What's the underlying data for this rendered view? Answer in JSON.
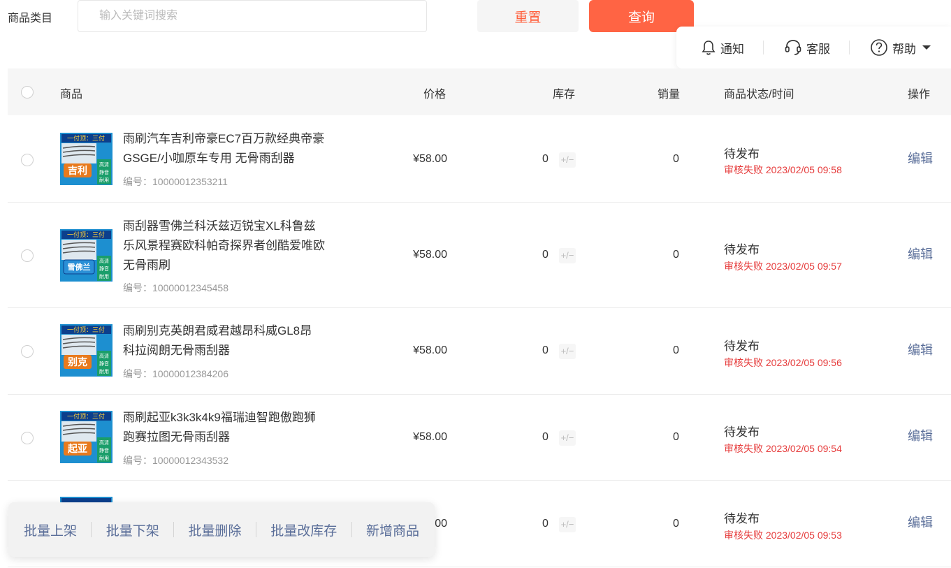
{
  "filter": {
    "category_label": "商品类目",
    "search_placeholder": "输入关键词搜索",
    "reset_label": "重置",
    "query_label": "查询"
  },
  "help_panel": {
    "notify_label": "通知",
    "service_label": "客服",
    "help_label": "帮助"
  },
  "table": {
    "columns": {
      "product": "商品",
      "price": "价格",
      "stock": "库存",
      "sales": "销量",
      "status": "商品状态/时间",
      "actions": "操作"
    },
    "rows": [
      {
        "badge_top": "一付顶：三付",
        "badge_brand": "吉利",
        "badge_side": [
          "高清",
          "静音",
          "耐用"
        ],
        "title": "雨刷汽车吉利帝豪EC7百万款经典帝豪GSGE/小咖原车专用 无骨雨刮器",
        "code": "编号：10000012353211",
        "price": "¥58.00",
        "stock": "0",
        "stock_edit": "+/−",
        "sales": "0",
        "status": "待发布",
        "time": "审核失败 2023/02/05 09:58",
        "edit": "编辑"
      },
      {
        "badge_top": "一付顶：三付",
        "badge_brand": "雪佛兰",
        "badge_side": [
          "高清",
          "静音",
          "耐用"
        ],
        "title": "雨刮器雪佛兰科沃兹迈锐宝XL科鲁兹乐风景程赛欧科帕奇探界者创酷爱唯欧无骨雨刷",
        "code": "编号：10000012345458",
        "price": "¥58.00",
        "stock": "0",
        "stock_edit": "+/−",
        "sales": "0",
        "status": "待发布",
        "time": "审核失败 2023/02/05 09:57",
        "edit": "编辑"
      },
      {
        "badge_top": "一付顶：三付",
        "badge_brand": "别克",
        "badge_side": [
          "高清",
          "静音",
          "耐用"
        ],
        "title": "雨刷别克英朗君威君越昂科威GL8昂科拉阅朗无骨雨刮器",
        "code": "编号：10000012384206",
        "price": "¥58.00",
        "stock": "0",
        "stock_edit": "+/−",
        "sales": "0",
        "status": "待发布",
        "time": "审核失败 2023/02/05 09:56",
        "edit": "编辑"
      },
      {
        "badge_top": "一付顶：三付",
        "badge_brand": "起亚",
        "badge_side": [
          "高清",
          "静音",
          "耐用"
        ],
        "title": "雨刷起亚k3k3k4k9福瑞迪智跑傲跑狮跑赛拉图无骨雨刮器",
        "code": "编号：10000012343532",
        "price": "¥58.00",
        "stock": "0",
        "stock_edit": "+/−",
        "sales": "0",
        "status": "待发布",
        "time": "审核失败 2023/02/05 09:54",
        "edit": "编辑"
      },
      {
        "price": "¥58.00",
        "stock": "0",
        "stock_edit": "+/−",
        "sales": "0",
        "status": "待发布",
        "time": "审核失败 2023/02/05 09:53",
        "edit": "编辑"
      }
    ]
  },
  "batch_actions": {
    "list_on": "批量上架",
    "list_off": "批量下架",
    "delete": "批量删除",
    "edit_stock": "批量改库存",
    "add_product": "新增商品"
  },
  "colors": {
    "accent": "#ff6444",
    "link": "#5a6e99",
    "error": "#e63c3c"
  }
}
